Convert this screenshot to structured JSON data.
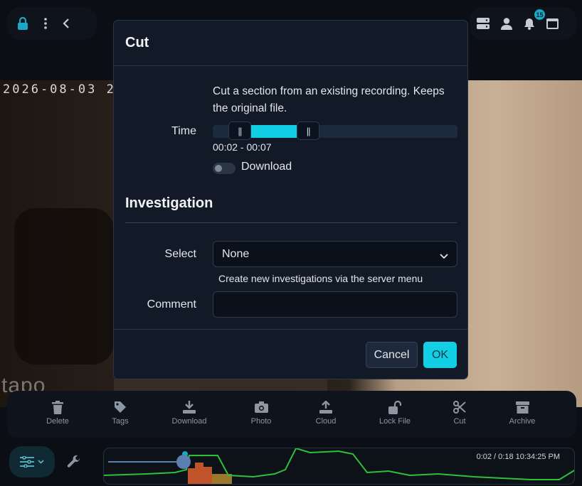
{
  "video": {
    "timestamp": "2026-08-03  2",
    "brand": "tapo"
  },
  "topbar": {
    "notification_count": "15"
  },
  "modal": {
    "title": "Cut",
    "description": "Cut a section from an existing recording. Keeps the original file.",
    "time_label": "Time",
    "slider": {
      "start_fraction": 0.11,
      "end_fraction": 0.39,
      "handle_glyph": "||"
    },
    "range_text": "00:02 - 00:07",
    "download_label": "Download",
    "download_enabled": false,
    "section_title": "Investigation",
    "select_label": "Select",
    "select_value": "None",
    "select_help": "Create new investigations via the server menu",
    "comment_label": "Comment",
    "comment_value": "",
    "cancel_label": "Cancel",
    "ok_label": "OK",
    "accent_color": "#12cfe6"
  },
  "toolbar": {
    "items": [
      {
        "label": "Delete",
        "icon": "trash-icon"
      },
      {
        "label": "Tags",
        "icon": "tag-icon"
      },
      {
        "label": "Download",
        "icon": "download-icon"
      },
      {
        "label": "Photo",
        "icon": "camera-icon"
      },
      {
        "label": "Cloud",
        "icon": "upload-icon"
      },
      {
        "label": "Lock File",
        "icon": "unlock-icon"
      },
      {
        "label": "Cut",
        "icon": "scissors-icon"
      },
      {
        "label": "Archive",
        "icon": "archive-icon"
      }
    ]
  },
  "timeline": {
    "time_readout": "0:02 / 0:18 10:34:25 PM",
    "position_fraction": 0.11
  }
}
